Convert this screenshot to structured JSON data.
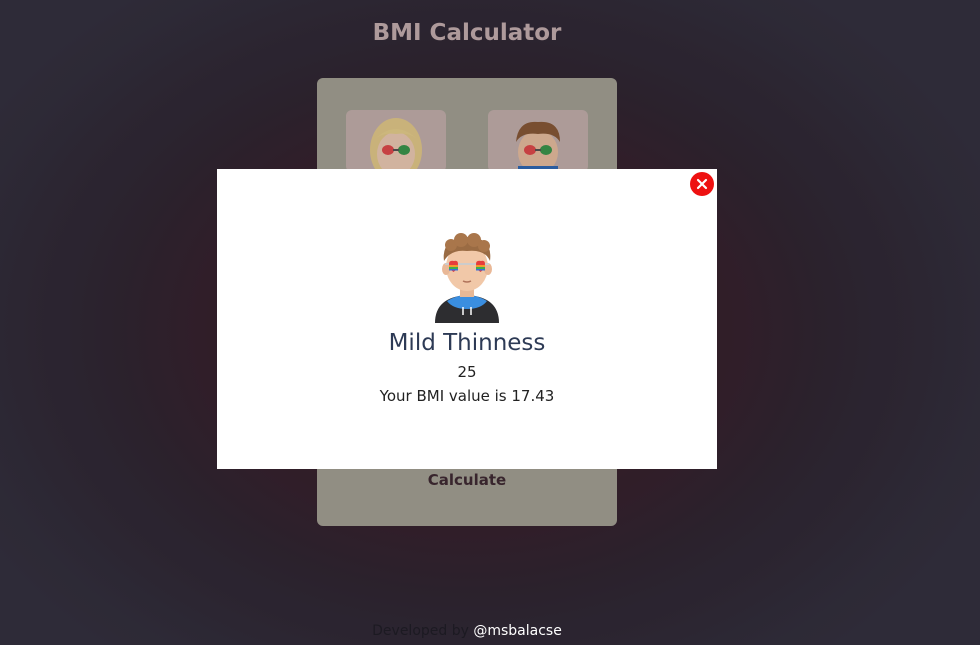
{
  "header": {
    "title": "BMI Calculator"
  },
  "card": {
    "gender_options": [
      {
        "name": "female",
        "icon": "female-avatar-icon"
      },
      {
        "name": "male",
        "icon": "male-avatar-icon"
      }
    ],
    "calculate_label": "Calculate"
  },
  "modal": {
    "close_icon": "close-icon",
    "avatar_icon": "male-avatar-icon",
    "category": "Mild Thinness",
    "value": "25",
    "bmi_text": "Your BMI value is 17.43"
  },
  "footer": {
    "prefix": "Developed by",
    "link_text": "@msbalacse"
  },
  "colors": {
    "card_bg": "#a7a597",
    "close_red": "#ee1111",
    "category_text": "#2d3a55"
  }
}
